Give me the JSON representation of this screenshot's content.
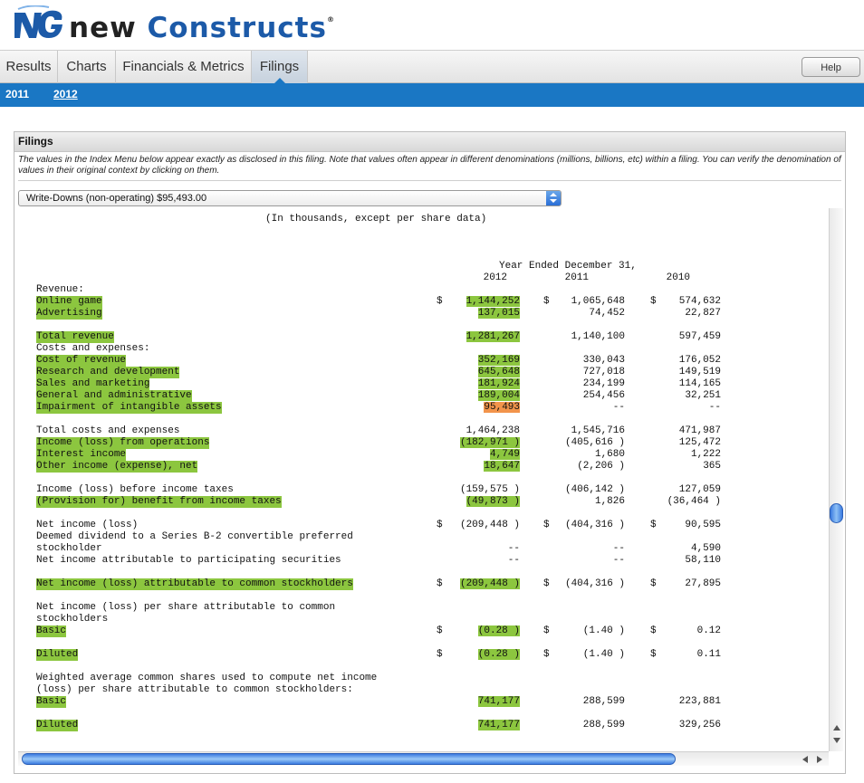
{
  "brand": {
    "name_part1": "new",
    "name_part2": "Constructs",
    "trademark": "®"
  },
  "nav": {
    "tabs": [
      {
        "label": "Results"
      },
      {
        "label": "Charts"
      },
      {
        "label": "Financials & Metrics"
      },
      {
        "label": "Filings"
      }
    ],
    "active_tab": "Filings",
    "help_label": "Help"
  },
  "years": {
    "items": [
      "2011",
      "2012"
    ],
    "selected": "2012"
  },
  "filings": {
    "title": "Filings",
    "description": "The values in the Index Menu below appear exactly as disclosed in this filing. Note that values often appear in different denominations (millions, billions, etc) within a filing. You can verify the denomination of values in their original context by clicking on them.",
    "selected_item": "Write-Downs (non-operating) $95,493.00"
  },
  "statement": {
    "note": "(In thousands, except per share data)",
    "period_header": "Year Ended December 31,",
    "years": [
      "2012",
      "2011",
      "2010"
    ],
    "rows": [
      {
        "label": "Revenue:"
      },
      {
        "label": "Online game",
        "hl": true,
        "c1": "1,144,252",
        "c1hl": true,
        "c2": "1,065,648",
        "c3": "574,632",
        "cur": true
      },
      {
        "label": "Advertising",
        "hl": true,
        "c1": "137,015",
        "c1hl": true,
        "c2": "74,452",
        "c3": "22,827"
      },
      {
        "label": "Total revenue",
        "hl": true,
        "c1": "1,281,267",
        "c1hl": true,
        "c2": "1,140,100",
        "c3": "597,459"
      },
      {
        "label": "Costs and expenses:"
      },
      {
        "label": "Cost of revenue",
        "hl": true,
        "c1": "352,169",
        "c1hl": true,
        "c2": "330,043",
        "c3": "176,052"
      },
      {
        "label": "Research and development",
        "hl": true,
        "c1": "645,648",
        "c1hl": true,
        "c2": "727,018",
        "c3": "149,519"
      },
      {
        "label": "Sales and marketing",
        "hl": true,
        "c1": "181,924",
        "c1hl": true,
        "c2": "234,199",
        "c3": "114,165"
      },
      {
        "label": "General and administrative",
        "hl": true,
        "c1": "189,004",
        "c1hl": true,
        "c2": "254,456",
        "c3": "32,251"
      },
      {
        "label": "Impairment of intangible assets",
        "hl": true,
        "c1": "95,493",
        "c1sel": true,
        "c2": "--",
        "c3": "--"
      },
      {
        "label": "Total costs and expenses",
        "c1": "1,464,238",
        "c2": "1,545,716",
        "c3": "471,987"
      },
      {
        "label": "Income (loss) from operations",
        "hl": true,
        "c1": "(182,971 )",
        "c1hl": true,
        "c2": "(405,616 )",
        "c3": "125,472"
      },
      {
        "label": "Interest income",
        "hl": true,
        "c1": "4,749",
        "c1hl": true,
        "c2": "1,680",
        "c3": "1,222"
      },
      {
        "label": "Other income (expense), net",
        "hl": true,
        "c1": "18,647",
        "c1hl": true,
        "c2": "(2,206 )",
        "c3": "365"
      },
      {
        "label": "Income (loss) before income taxes",
        "c1": "(159,575 )",
        "c2": "(406,142 )",
        "c3": "127,059"
      },
      {
        "label": "(Provision for) benefit from income taxes",
        "hl": true,
        "c1": "(49,873 )",
        "c1hl": true,
        "c2": "1,826",
        "c3": "(36,464 )"
      },
      {
        "label": "Net income (loss)",
        "c1": "(209,448 )",
        "c2": "(404,316 )",
        "c3": "90,595",
        "cur": true
      },
      {
        "label": "Deemed dividend to a Series B-2 convertible preferred"
      },
      {
        "label": "stockholder",
        "c1": "--",
        "c2": "--",
        "c3": "4,590"
      },
      {
        "label": "Net income attributable to participating securities",
        "c1": "--",
        "c2": "--",
        "c3": "58,110"
      },
      {
        "label": "Net income (loss) attributable to common stockholders",
        "hl": true,
        "c1": "(209,448 )",
        "c1hl": true,
        "c2": "(404,316 )",
        "c3": "27,895",
        "cur": true
      },
      {
        "label": "Net income (loss) per share attributable to common"
      },
      {
        "label": "stockholders"
      },
      {
        "label": "Basic",
        "hl": true,
        "c1": "(0.28 )",
        "c1hl": true,
        "c2": "(1.40 )",
        "c3": "0.12",
        "cur": true
      },
      {
        "label": "Diluted",
        "hl": true,
        "c1": "(0.28 )",
        "c1hl": true,
        "c2": "(1.40 )",
        "c3": "0.11",
        "cur": true
      },
      {
        "label": "Weighted average common shares used to compute net income"
      },
      {
        "label": "(loss) per share attributable to common stockholders:"
      },
      {
        "label": "Basic",
        "hl": true,
        "c1": "741,177",
        "c1hl": true,
        "c2": "288,599",
        "c3": "223,881"
      },
      {
        "label": "Diluted",
        "hl": true,
        "c1": "741,177",
        "c1hl": true,
        "c2": "288,599",
        "c3": "329,256"
      }
    ],
    "currency_symbol": "$"
  }
}
